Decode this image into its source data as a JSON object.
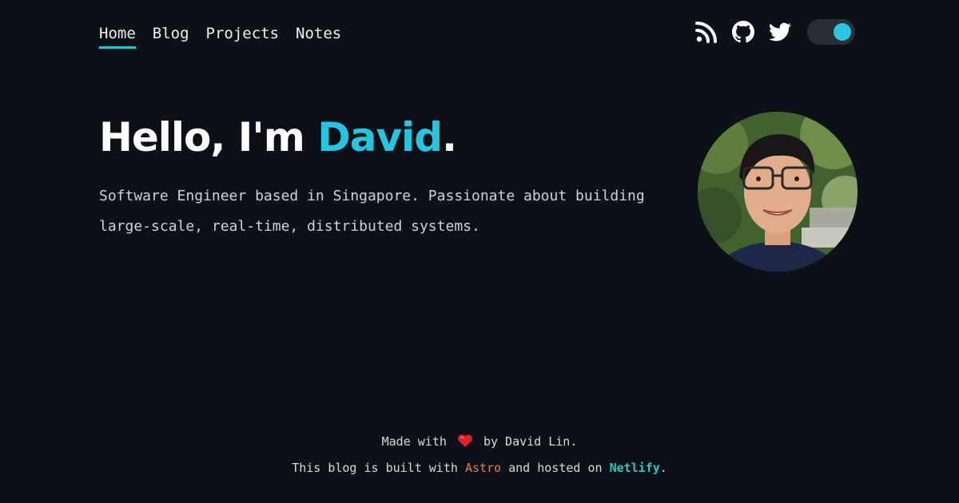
{
  "nav": {
    "items": [
      {
        "label": "Home",
        "active": true
      },
      {
        "label": "Blog"
      },
      {
        "label": "Projects"
      },
      {
        "label": "Notes"
      }
    ]
  },
  "header_icons": [
    "rss-icon",
    "github-icon",
    "twitter-icon"
  ],
  "theme_toggle": {
    "state": "dark"
  },
  "hero": {
    "greeting": "Hello, I'm",
    "name": "David",
    "punct": ".",
    "description": "Software Engineer based in Singapore. Passionate about building large-scale, real-time, distributed systems."
  },
  "footer": {
    "line1_prefix": "Made with",
    "line1_suffix": "by David Lin.",
    "line2_prefix": "This blog is built with",
    "line2_link1": "Astro",
    "line2_middle": "and hosted on",
    "line2_link2": "Netlify",
    "line2_end": "."
  },
  "colors": {
    "background": "#0d1117",
    "accent": "#22c6e0",
    "astro": "#e8802c",
    "netlify": "#2ec4c6",
    "heart": "#e0202e"
  }
}
